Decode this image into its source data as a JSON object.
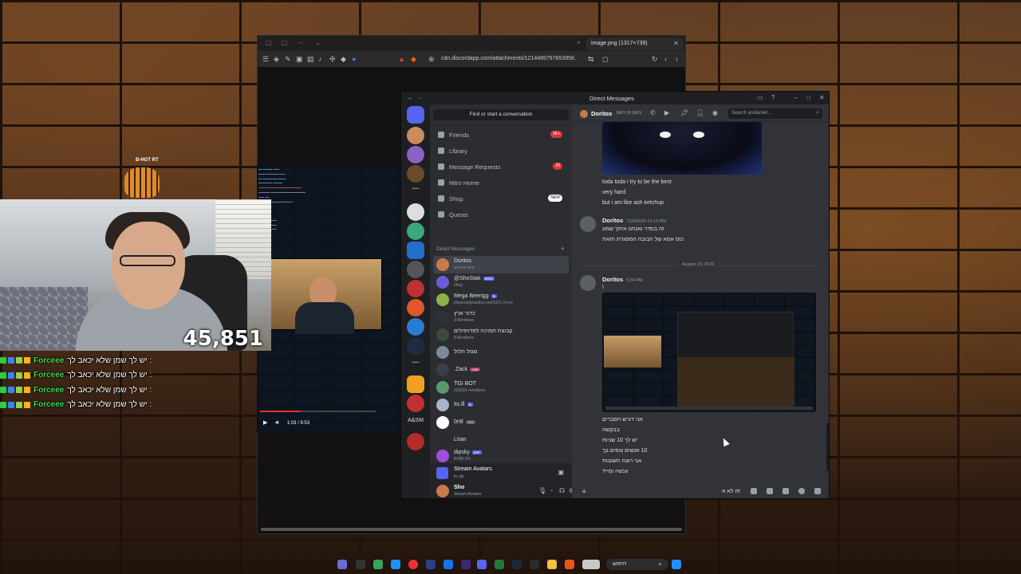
{
  "browser": {
    "tab_title": "image.png (1317×739)",
    "url": "cdn.discordapp.com/attachments/1214489797653958...",
    "tab_close": "✕"
  },
  "stream_overlay": {
    "viewer_count": "45,851",
    "tiger_label": "B-HOT RT",
    "video_time": "1:03 / 9:53",
    "chat_lines": [
      {
        "user": "Forceee",
        "message": "יש לך שמן שלא יכאב לך :"
      },
      {
        "user": "Forceee",
        "message": "יש לך שמן שלא יכאב לך :"
      },
      {
        "user": "Forceee",
        "message": "יש לך שמן שלא יכאב לך :"
      },
      {
        "user": "Forceee",
        "message": "יש לך שמן שלא יכאב לך :"
      }
    ]
  },
  "discord": {
    "window_title": "Direct Messages",
    "find_placeholder": "Find or start a conversation",
    "nav": [
      {
        "label": "Friends",
        "badge": "1K+",
        "badge_color": "#da373c"
      },
      {
        "label": "Library",
        "badge": "",
        "badge_color": ""
      },
      {
        "label": "Message Requests",
        "badge": "29",
        "badge_color": "#da373c"
      },
      {
        "label": "Nitro Home",
        "badge": "",
        "badge_color": ""
      },
      {
        "label": "Shop",
        "badge": "NEW",
        "badge_color": "#ffffff"
      },
      {
        "label": "Quests",
        "badge": "",
        "badge_color": ""
      }
    ],
    "dm_header": "Direct Messages",
    "dms": [
      {
        "name": "Doritos",
        "sub": "היום זה היום",
        "tag": "",
        "color": "#c77b49"
      },
      {
        "name": "@ShoStak",
        "sub": "2Key",
        "tag": "DISC",
        "color": "#6b5bd6"
      },
      {
        "name": "Mega Beerigg",
        "sub": "playisraelpractice.net/פעילה:1021",
        "tag": "IL",
        "color": "#8fb34a"
      },
      {
        "name": "כדור ארץ",
        "sub": "3 Members",
        "tag": "",
        "color": "#2f3136"
      },
      {
        "name": "קבוצת תמיכה לפדויפילים",
        "sub": "8 Members",
        "tag": "",
        "color": "#3c4a3a"
      },
      {
        "name": "מגזל חלול",
        "sub": "",
        "tag": "",
        "color": "#7a8a99"
      },
      {
        "name": ".Zack",
        "sub": "",
        "tag": "cute",
        "color": "#3b3f45"
      },
      {
        "name": "TGI BOT",
        "sub": "323016 members",
        "tag": "",
        "color": "#5a9a6a"
      },
      {
        "name": "its.lll",
        "sub": "",
        "tag": "IL",
        "color": "#aab4c8"
      },
      {
        "name": "0r9l",
        "sub": "",
        "tag": "נננה",
        "color": "#ffffff"
      },
      {
        "name": "Liran",
        "sub": "",
        "tag": "",
        "color": "#2a2b30"
      },
      {
        "name": "dipsky",
        "sub": "ROBLOX",
        "tag": "יפיק",
        "color": "#a14ee0"
      }
    ],
    "stream_avatars": {
      "name": "Stream Avatars",
      "sub": "to clip"
    },
    "user": {
      "name": "Sho",
      "sub": "Stream Avatars"
    },
    "chat_header": {
      "name": "Doritos",
      "status": "היום זה היום",
      "search_placeholder": "Search anidaniel..."
    },
    "messages": [
      {
        "line1": "toda toda i try to be the best",
        "line2": "very hard",
        "line3": "but i am like ash ketchup"
      },
      {
        "author": "Doritos",
        "time": "7/24/2026 10:13 PM",
        "line1": "זה בסדר ואנחנו איתך שמע",
        "line2": "כוס אמא של הבובה המפגרת הזאת"
      },
      {
        "author": "Doritos",
        "time": "5:34 PM",
        "line1": "\\"
      }
    ],
    "date_separator": "August 23, 2026",
    "lines_after_image": [
      "אני דורש הסברים",
      "בבקשה",
      "יש לך 10 שניות",
      "10 אנשים צופים בך",
      "אני רוצה תשובות",
      "עכשיו ומייד"
    ],
    "composer_text": "זה לא א"
  },
  "taskbar": {
    "search_placeholder": "חיפוש"
  }
}
